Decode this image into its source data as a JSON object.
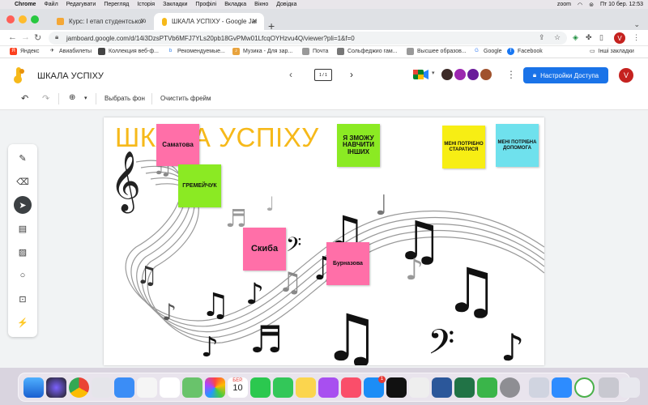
{
  "menubar": {
    "app": "Chrome",
    "items": [
      "Файл",
      "Редагувати",
      "Перегляд",
      "Історія",
      "Закладки",
      "Профілі",
      "Вкладка",
      "Вікно",
      "Довідка"
    ],
    "clock": "Пт 10 бер.  12:53",
    "zoom": "zoom"
  },
  "tabs": [
    {
      "title": "Курс: І етап студентської Олі..."
    },
    {
      "title": "ШКАЛА УСПІХУ - Google Jam..."
    }
  ],
  "address": {
    "url": "jamboard.google.com/d/14i3DzsPTVb6MFJ7YLs20pb18GvPMw01LfcqOYHzvu4Q/viewer?pli=1&f=0"
  },
  "profile_initial": "V",
  "bookmarks": [
    {
      "label": "Яндекс",
      "color": "#fc3f1d"
    },
    {
      "label": "Авиабилеты",
      "color": "#222"
    },
    {
      "label": "Коллекция веб-ф...",
      "color": "#444"
    },
    {
      "label": "Рекомендуемые...",
      "color": "#2b7de9"
    },
    {
      "label": "Музика - Для зар...",
      "color": "#e8a33d"
    },
    {
      "label": "Почта",
      "color": "#888"
    },
    {
      "label": "Сольфеджио гам...",
      "color": "#666"
    },
    {
      "label": "Высшее образов...",
      "color": "#888"
    },
    {
      "label": "Google",
      "color": "#4285f4"
    },
    {
      "label": "Facebook",
      "color": "#1877f2"
    }
  ],
  "bookmarks_other": "Інші закладки",
  "jam": {
    "title": "ШКАЛА УСПІХУ",
    "frame_indicator": "1 / 1",
    "share_label": "Настройки Доступа",
    "user_initial": "V"
  },
  "toolbar": {
    "set_background": "Выбрать фон",
    "clear_frame": "Очистить фрейм"
  },
  "board": {
    "title": "ШКАЛА УСПІХУ",
    "notes": [
      {
        "text": "Саматова",
        "color": "#ff6fa8"
      },
      {
        "text": "ГРЕМЕЙЧУК",
        "color": "#8bea23"
      },
      {
        "text": "Я ЗМОЖУ НАВЧИТИ ІНШИХ",
        "color": "#8bea23"
      },
      {
        "text": "МЕНІ ПОТРІБНО СТАРАТИСЯ",
        "color": "#f7ee14"
      },
      {
        "text": "МЕНІ ПОТРІБНА ДОПОМОГА",
        "color": "#6fe1ed"
      },
      {
        "text": "Скиба",
        "color": "#ff6fa8"
      },
      {
        "text": "Бурназова",
        "color": "#ff6fa8"
      }
    ]
  },
  "dock": {
    "calendar_month": "БЕР.",
    "calendar_day": "10",
    "badge": "1"
  }
}
